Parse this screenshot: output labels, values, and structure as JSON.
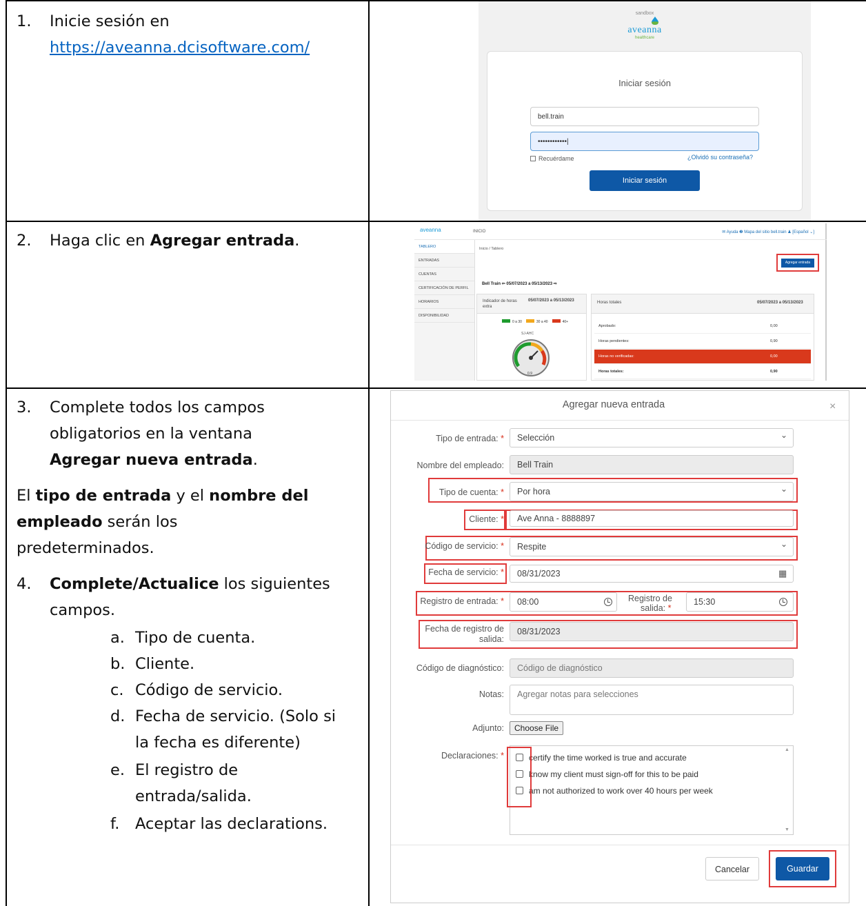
{
  "steps": {
    "s1": {
      "num": "1.",
      "text": "Inicie sesión en",
      "link": "https://aveanna.dcisoftware.com/"
    },
    "s2": {
      "num": "2.",
      "pre": "Haga clic en ",
      "bold": "Agregar entrada",
      "post": "."
    },
    "s3": {
      "num": "3.",
      "line1": "Complete todos los campos",
      "line2": "obligatorios en la ventana",
      "bold": "Agregar nueva entrada",
      "post": "."
    },
    "p": {
      "w1": "El ",
      "b1": "tipo de entrada",
      "w2": " y el ",
      "b2": "nombre del",
      "b3": "empleado",
      "w3": " serán los",
      "w4": "predeterminados."
    },
    "s4": {
      "num": "4.",
      "bold": "Complete/Actualice",
      "post": " los siguientes",
      "line2": "campos."
    },
    "subs": [
      {
        "letter": "a.",
        "text": "Tipo de cuenta."
      },
      {
        "letter": "b.",
        "text": "Cliente."
      },
      {
        "letter": "c.",
        "text": "Código de servicio."
      },
      {
        "letter": "d.",
        "text": "Fecha de servicio. (Solo si",
        "text2": "la fecha es diferente)"
      },
      {
        "letter": "e.",
        "text": "El registro de",
        "text2": "entrada/salida."
      },
      {
        "letter": "f.",
        "text": "Aceptar las declarations."
      }
    ]
  },
  "login": {
    "sandbox": "sandbox",
    "logo": "aveanna",
    "logo_sub": "healthcare",
    "title": "Iniciar sesión",
    "username": "bell.train",
    "password": "••••••••••••|",
    "remember": "Recuérdame",
    "forgot": "¿Olvidó su contraseña?",
    "button": "Iniciar sesión"
  },
  "dashboard": {
    "logo": "aveanna",
    "inicio": "INICIO",
    "top_right": "✉   Ayuda ❷  Mapa del sitio  bell.train  ♟ [Español ⌄]",
    "side": [
      "TABLERO",
      "ENTRADAS",
      "CUENTAS",
      "CERTIFICACIÓN DE PERFIL",
      "HORARIOS",
      "DISPONIBILIDAD"
    ],
    "breadcrumb": "Inicio / Tablero",
    "add_button": "Agregar entrada",
    "week": "Bell Train  ⇦ 05/07/2023 a 05/13/2023 ⇨",
    "panel1_title": "Indicador de horas extra",
    "panel1_range": "05/07/2023 a 05/13/2023",
    "legend": [
      "0 a 30",
      "30 a 40",
      "40+"
    ],
    "gauge_label": "SJ-AHC",
    "gauge_value": "0.9",
    "panel2_title": "Horas totales",
    "panel2_range": "05/07/2023 a 05/13/2023",
    "rows": [
      {
        "label": "Aprobado:",
        "value": "0,00"
      },
      {
        "label": "Horas pendientes:",
        "value": "0,90"
      },
      {
        "label": "Horas no verificadas:",
        "value": "0,00"
      },
      {
        "label": "Horas totales:",
        "value": "0,90"
      }
    ]
  },
  "modal": {
    "title": "Agregar nueva entrada",
    "close": "×",
    "tipo_entrada_label": "Tipo de entrada:",
    "tipo_entrada_value": "Selección",
    "nombre_label": "Nombre del empleado:",
    "nombre_value": "Bell Train",
    "tipo_cuenta_label": "Tipo de cuenta:",
    "tipo_cuenta_value": "Por hora",
    "cliente_label": "Cliente:",
    "cliente_value": "Ave Anna - 8888897",
    "codigo_label": "Código de servicio:",
    "codigo_value": "Respite",
    "fecha_label": "Fecha de servicio:",
    "fecha_value": "08/31/2023",
    "entrada_label": "Registro de entrada:",
    "entrada_value": "08:00",
    "salida_label1": "Registro de",
    "salida_label2": "salida:",
    "salida_value": "15:30",
    "fecha_salida_label1": "Fecha de registro de",
    "fecha_salida_label2": "salida:",
    "fecha_salida_value": "08/31/2023",
    "diag_label": "Código de diagnóstico:",
    "diag_placeholder": "Código de diagnóstico",
    "notas_label": "Notas:",
    "notas_placeholder": "Agregar notas para selecciones",
    "adjunto_label": "Adjunto:",
    "choose_file": "Choose File",
    "decl_label": "Declaraciones:",
    "declarations": [
      "certify the time worked is true and accurate",
      "know my client must sign-off for this to be paid",
      "am not authorized to work over 40 hours per week"
    ],
    "cancel": "Cancelar",
    "save": "Guardar"
  }
}
